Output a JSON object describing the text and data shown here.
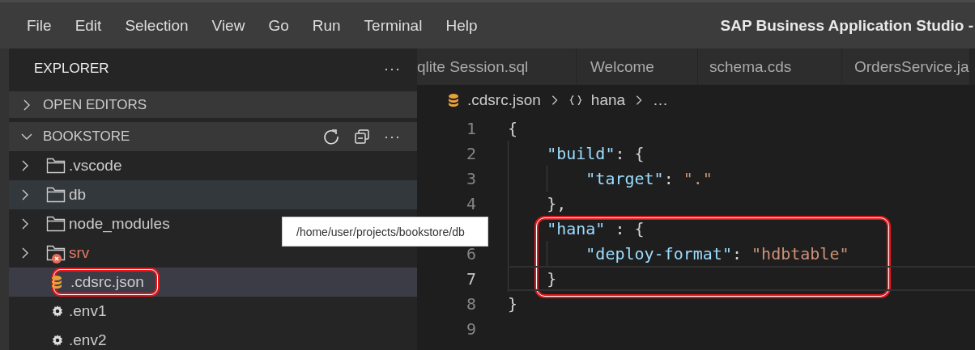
{
  "menu": [
    "File",
    "Edit",
    "Selection",
    "View",
    "Go",
    "Run",
    "Terminal",
    "Help"
  ],
  "window": {
    "title": "SAP Business Application Studio -"
  },
  "sidebar": {
    "title": "EXPLORER",
    "more": "···",
    "sections": [
      {
        "label": "OPEN EDITORS",
        "expanded": false
      },
      {
        "label": "BOOKSTORE",
        "expanded": true,
        "more": "···"
      }
    ],
    "tree": [
      {
        "kind": "folder",
        "label": ".vscode",
        "selected": false,
        "hovered": false,
        "error": false
      },
      {
        "kind": "folder",
        "label": "db",
        "selected": false,
        "hovered": true,
        "error": false
      },
      {
        "kind": "folder",
        "label": "node_modules",
        "selected": false,
        "hovered": false,
        "error": false
      },
      {
        "kind": "folder",
        "label": "srv",
        "selected": false,
        "hovered": false,
        "error": true
      },
      {
        "kind": "database",
        "label": ".cdsrc.json",
        "selected": true,
        "hovered": false,
        "error": false,
        "annotated": true
      },
      {
        "kind": "gear",
        "label": ".env1",
        "selected": false,
        "hovered": false,
        "error": false
      },
      {
        "kind": "gear",
        "label": ".env2",
        "selected": false,
        "hovered": false,
        "error": false
      }
    ]
  },
  "tooltip": "/home/user/projects/bookstore/db",
  "tabs": [
    {
      "label": "qlite Session.sql",
      "selected": false
    },
    {
      "label": "Welcome",
      "selected": false
    },
    {
      "label": "schema.cds",
      "selected": false
    },
    {
      "label": "OrdersService.ja",
      "selected": false
    }
  ],
  "breadcrumb": {
    "file": ".cdsrc.json",
    "symbol": "hana",
    "ellipsis": "…"
  },
  "lines": [
    {
      "number": "1",
      "current": false,
      "annotated": false,
      "tokens": [
        {
          "kind": "punct",
          "text": "{"
        }
      ]
    },
    {
      "number": "2",
      "current": false,
      "annotated": false,
      "tokens": [
        {
          "kind": "key",
          "text": "    \"build\""
        },
        {
          "kind": "punct",
          "text": ": {"
        }
      ]
    },
    {
      "number": "3",
      "current": false,
      "annotated": false,
      "tokens": [
        {
          "kind": "key",
          "text": "        \"target\""
        },
        {
          "kind": "punct",
          "text": ": "
        },
        {
          "kind": "string",
          "text": "\".\""
        }
      ]
    },
    {
      "number": "4",
      "current": false,
      "annotated": false,
      "tokens": [
        {
          "kind": "punct",
          "text": "    },"
        }
      ]
    },
    {
      "current": false,
      "annotated": true,
      "tokens": [
        {
          "kind": "key",
          "text": "    \"hana\""
        },
        {
          "kind": "punct",
          "text": " : {"
        }
      ]
    },
    {
      "number": "6",
      "current": false,
      "annotated": true,
      "tokens": [
        {
          "kind": "key",
          "text": "        \"deploy-format\""
        },
        {
          "kind": "punct",
          "text": ": "
        },
        {
          "kind": "string",
          "text": "\"hdbtable\""
        }
      ]
    },
    {
      "number": "7",
      "current": true,
      "annotated": true,
      "tokens": [
        {
          "kind": "punct",
          "text": "    }"
        }
      ]
    },
    {
      "number": "8",
      "current": false,
      "annotated": false,
      "tokens": [
        {
          "kind": "punct",
          "text": "}"
        }
      ]
    },
    {
      "number": "9",
      "current": false,
      "annotated": false
    }
  ]
}
